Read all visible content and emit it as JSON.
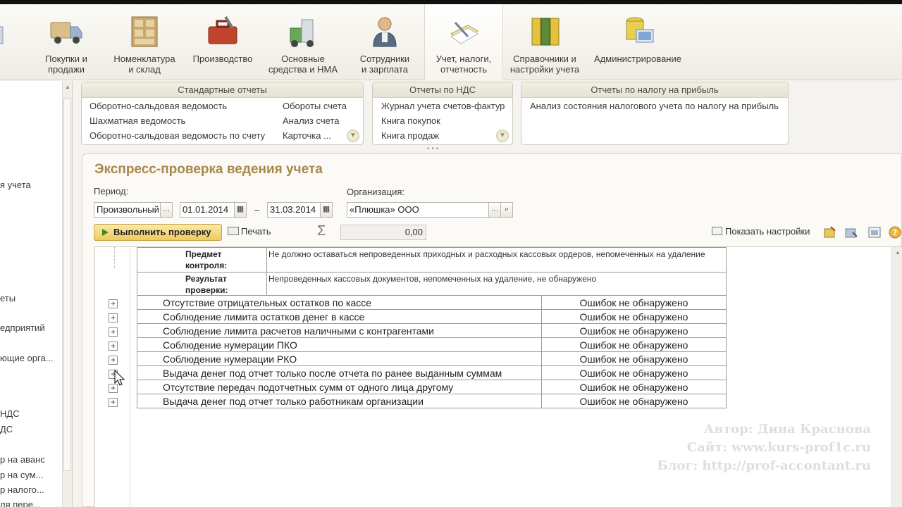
{
  "toolbar": {
    "items": [
      {
        "label": "Покупки и\nпродажи",
        "icon": "truck-icon"
      },
      {
        "label": "Номенклатура\nи склад",
        "icon": "warehouse-shelves-icon"
      },
      {
        "label": "Производство",
        "icon": "toolbox-icon"
      },
      {
        "label": "Основные\nсредства и НМА",
        "icon": "fixed-assets-icon"
      },
      {
        "label": "Сотрудники\nи зарплата",
        "icon": "employee-icon"
      },
      {
        "label": "Учет, налоги,\nотчетность",
        "icon": "accounting-papers-icon"
      },
      {
        "label": "Справочники и\nнастройки учета",
        "icon": "binders-icon"
      },
      {
        "label": "Администрирование",
        "icon": "admin-computer-icon"
      }
    ]
  },
  "left_panel": {
    "items": [
      "я учета",
      "еты",
      "едприятий",
      "ющие орга...",
      "НДС",
      "ДС",
      "р на аванс",
      "р на сум...",
      "р налого...",
      "ля пере..."
    ]
  },
  "groups": {
    "standard": {
      "title": "Стандартные отчеты",
      "col1": [
        "Оборотно-сальдовая ведомость",
        "Шахматная ведомость",
        "Оборотно-сальдовая ведомость по счету"
      ],
      "col2": [
        "Обороты счета",
        "Анализ счета",
        "Карточка ..."
      ]
    },
    "vat": {
      "title": "Отчеты по НДС",
      "links": [
        "Журнал учета счетов-фактур",
        "Книга покупок",
        "Книга продаж"
      ]
    },
    "profit": {
      "title": "Отчеты по налогу на прибыль",
      "links": [
        "Анализ состояния налогового учета по налогу на прибыль"
      ]
    }
  },
  "form": {
    "title": "Экспресс-проверка ведения учета",
    "period_label": "Период:",
    "period_type": "Произвольный",
    "date_from": "01.01.2014",
    "dash": "–",
    "date_to": "31.03.2014",
    "org_label": "Организация:",
    "org_value": "«Плюшка» ООО",
    "run_button": "Выполнить проверку",
    "print_button": "Печать",
    "sigma": "Σ",
    "sum_value": "0,00",
    "show_settings": "Показать настройки"
  },
  "detail": [
    {
      "key": "Предмет контроля:",
      "value": "Не должно оставаться непроведенных приходных и расходных кассовых ордеров, непомеченных на удаление"
    },
    {
      "key": "Результат проверки:",
      "value": "Непроведенных кассовых документов, непомеченных на удаление, не обнаружено"
    }
  ],
  "checks": [
    {
      "name": "Отсутствие отрицательных остатков по кассе",
      "status": "Ошибок не обнаружено"
    },
    {
      "name": "Соблюдение лимита остатков денег в кассе",
      "status": "Ошибок не обнаружено"
    },
    {
      "name": "Соблюдение лимита расчетов наличными с контрагентами",
      "status": "Ошибок не обнаружено"
    },
    {
      "name": "Соблюдение нумерации ПКО",
      "status": "Ошибок не обнаружено"
    },
    {
      "name": "Соблюдение нумерации РКО",
      "status": "Ошибок не обнаружено"
    },
    {
      "name": "Выдача денег под отчет только после отчета по ранее выданным суммам",
      "status": "Ошибок не обнаружено"
    },
    {
      "name": "Отсутствие передач подотчетных сумм от одного лица другому",
      "status": "Ошибок не обнаружено"
    },
    {
      "name": "Выдача денег под отчет только работникам организации",
      "status": "Ошибок не обнаружено"
    }
  ],
  "watermark": {
    "line1": "Автор: Дина Краснова",
    "line2": "Сайт: www.kurs-prof1c.ru",
    "line3": "Блог: http://prof-accontant.ru"
  },
  "colors": {
    "title": "#a8874a",
    "run_button": "#efca5d",
    "run_icon": "#3d8a22"
  }
}
